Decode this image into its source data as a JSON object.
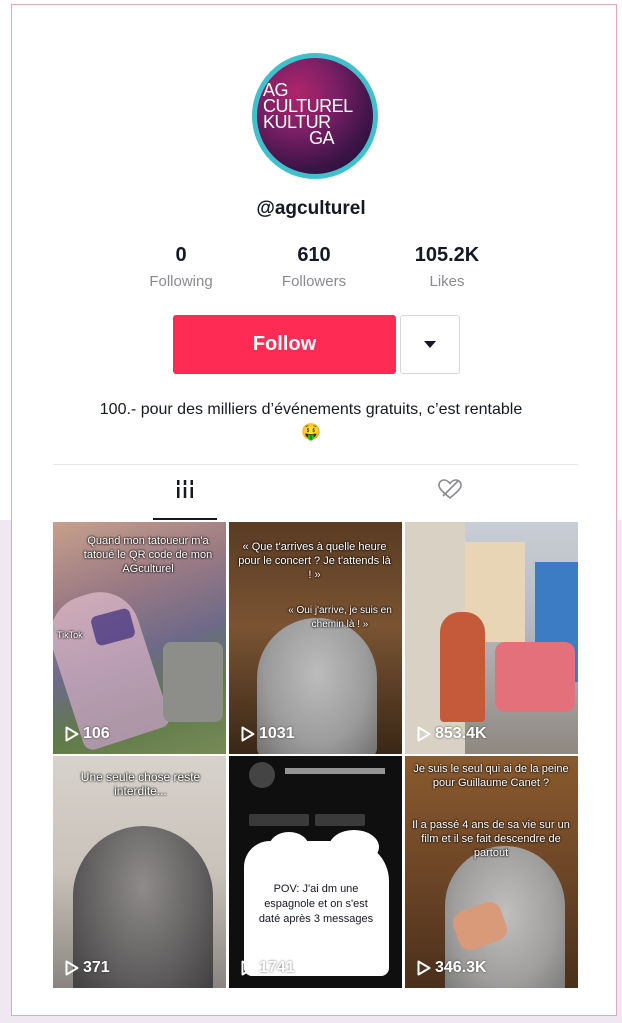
{
  "profile": {
    "avatar_lines": [
      "AG",
      "CULTUREL",
      "KULTUR",
      "GA"
    ],
    "username": "@agculturel",
    "stats": [
      {
        "value": "0",
        "label": "Following"
      },
      {
        "value": "610",
        "label": "Followers"
      },
      {
        "value": "105.2K",
        "label": "Likes"
      }
    ],
    "follow_label": "Follow",
    "bio": "100.- pour des milliers d’événements gratuits, c’est rentable 🤑"
  },
  "tabs": {
    "videos_icon": "grid-lines-icon",
    "liked_icon": "heart-slash-icon"
  },
  "videos": [
    {
      "views": "106",
      "caption": "Quand mon tatoueur m'a tatoué le QR code de mon AGculturel",
      "badge": "TikTok"
    },
    {
      "views": "1031",
      "caption": "« Que t'arrives à quelle heure pour le concert ? Je t'attends là ! »",
      "caption2": "« Oui j'arrive, je suis en chemin là ! »"
    },
    {
      "views": "853.4K",
      "caption": ""
    },
    {
      "views": "371",
      "caption": "Une seule chose reste interdite..."
    },
    {
      "views": "1741",
      "caption": "POV: J'ai dm une espagnole et on s'est daté après 3 messages"
    },
    {
      "views": "346.3K",
      "caption": "Je suis le seul qui ai de la peine pour Guillaume Canet ?",
      "caption2": "Il a passé 4 ans de sa vie sur un film et il se fait descendre de partout"
    }
  ],
  "colors": {
    "follow": "#fe2c55",
    "avatar_ring": "#3fc0cc",
    "text": "#161823",
    "muted": "#8a8b91"
  }
}
